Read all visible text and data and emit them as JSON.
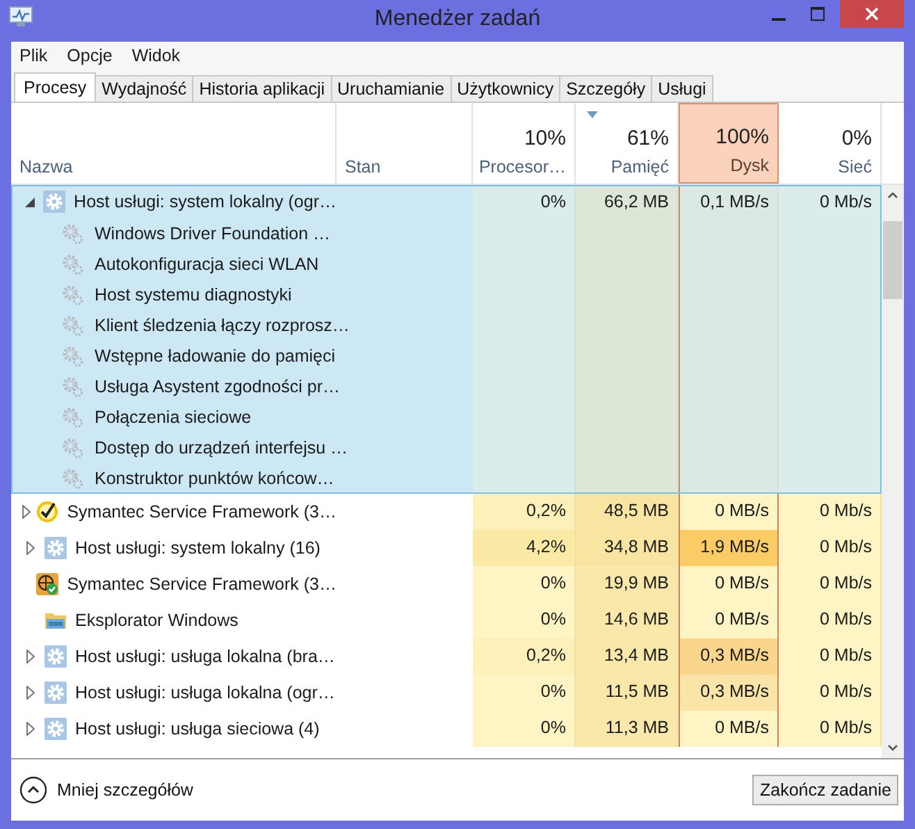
{
  "window": {
    "title": "Menedżer zadań"
  },
  "menu": [
    "Plik",
    "Opcje",
    "Widok"
  ],
  "tabs": [
    {
      "label": "Procesy",
      "selected": true
    },
    {
      "label": "Wydajność",
      "selected": false
    },
    {
      "label": "Historia aplikacji",
      "selected": false
    },
    {
      "label": "Uruchamianie",
      "selected": false
    },
    {
      "label": "Użytkownicy",
      "selected": false
    },
    {
      "label": "Szczegóły",
      "selected": false
    },
    {
      "label": "Usługi",
      "selected": false
    }
  ],
  "columns": [
    {
      "label": "Nazwa"
    },
    {
      "label": "Stan"
    },
    {
      "label": "Procesor…",
      "total": "10%",
      "sorted": false,
      "highlighted": false
    },
    {
      "label": "Pamięć",
      "total": "61%",
      "sorted": true,
      "highlighted": false
    },
    {
      "label": "Dysk",
      "total": "100%",
      "sorted": false,
      "highlighted": true
    },
    {
      "label": "Sieć",
      "total": "0%",
      "sorted": false,
      "highlighted": false
    }
  ],
  "processes": [
    {
      "name": "Host usługi: system lokalny (ogr…",
      "kind": "service",
      "expanded": true,
      "selected": true,
      "cells": [
        {
          "text": "0%",
          "color": "#dbedea"
        },
        {
          "text": "66,2 MB",
          "color": "#dce7d8"
        },
        {
          "text": "0,1 MB/s",
          "color": "#dae9e4"
        },
        {
          "text": "0 Mb/s",
          "color": "#dbedea"
        }
      ],
      "children": [
        {
          "name": "Windows Driver Foundation …"
        },
        {
          "name": "Autokonfiguracja sieci WLAN"
        },
        {
          "name": "Host systemu diagnostyki"
        },
        {
          "name": "Klient śledzenia łączy rozprosz…"
        },
        {
          "name": "Wstępne ładowanie do pamięci"
        },
        {
          "name": "Usługa Asystent zgodności pr…"
        },
        {
          "name": "Połączenia sieciowe"
        },
        {
          "name": "Dostęp do urządzeń interfejsu …"
        },
        {
          "name": "Konstruktor punktów końcow…"
        }
      ]
    },
    {
      "name": "Symantec Service Framework (3…",
      "kind": "check",
      "expanded": false,
      "selected": false,
      "cells": [
        {
          "text": "0,2%",
          "color": "#fdf0b8"
        },
        {
          "text": "48,5 MB",
          "color": "#f8e5a2"
        },
        {
          "text": "0 MB/s",
          "color": "#fff4c4"
        },
        {
          "text": "0 Mb/s",
          "color": "#fff4c4"
        }
      ]
    },
    {
      "name": "Host usługi: system lokalny (16)",
      "kind": "service",
      "expanded": false,
      "selected": false,
      "cells": [
        {
          "text": "4,2%",
          "color": "#fbeaa6"
        },
        {
          "text": "34,8 MB",
          "color": "#f8e5a2"
        },
        {
          "text": "1,9 MB/s",
          "color": "#fbcc66"
        },
        {
          "text": "0 Mb/s",
          "color": "#fff4c4"
        }
      ]
    },
    {
      "name": "Symantec Service Framework (3…",
      "kind": "globe",
      "selected": false,
      "cells": [
        {
          "text": "0%",
          "color": "#fff4c4"
        },
        {
          "text": "19,9 MB",
          "color": "#f9e8aa"
        },
        {
          "text": "0 MB/s",
          "color": "#fff4c4"
        },
        {
          "text": "0 Mb/s",
          "color": "#fff4c4"
        }
      ]
    },
    {
      "name": "Eksplorator Windows",
      "kind": "folder",
      "selected": false,
      "cells": [
        {
          "text": "0%",
          "color": "#fff4c4"
        },
        {
          "text": "14,6 MB",
          "color": "#f9e8aa"
        },
        {
          "text": "0 MB/s",
          "color": "#fff4c4"
        },
        {
          "text": "0 Mb/s",
          "color": "#fff4c4"
        }
      ]
    },
    {
      "name": "Host usługi: usługa lokalna (bra…",
      "kind": "service",
      "expanded": false,
      "selected": false,
      "cells": [
        {
          "text": "0,2%",
          "color": "#fdf0b8"
        },
        {
          "text": "13,4 MB",
          "color": "#f9e8aa"
        },
        {
          "text": "0,3 MB/s",
          "color": "#fad68c"
        },
        {
          "text": "0 Mb/s",
          "color": "#fff4c4"
        }
      ]
    },
    {
      "name": "Host usługi: usługa lokalna (ogr…",
      "kind": "service",
      "expanded": false,
      "selected": false,
      "cells": [
        {
          "text": "0%",
          "color": "#fff4c4"
        },
        {
          "text": "11,5 MB",
          "color": "#f9e8aa"
        },
        {
          "text": "0,3 MB/s",
          "color": "#fbe4a8"
        },
        {
          "text": "0 Mb/s",
          "color": "#fff4c4"
        }
      ]
    },
    {
      "name": "Host usługi: usługa sieciowa (4)",
      "kind": "service",
      "expanded": false,
      "selected": false,
      "cells": [
        {
          "text": "0%",
          "color": "#fff4c4"
        },
        {
          "text": "11,3 MB",
          "color": "#f9e8aa"
        },
        {
          "text": "0 MB/s",
          "color": "#fff4c4"
        },
        {
          "text": "0 Mb/s",
          "color": "#fff4c4"
        }
      ]
    }
  ],
  "footer": {
    "toggle": "Mniej szczegółów",
    "button": "Zakończ zadanie"
  }
}
